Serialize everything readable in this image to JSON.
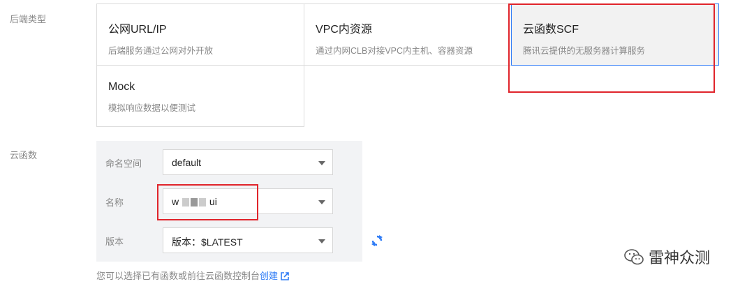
{
  "labels": {
    "backend_type": "后端类型",
    "scf": "云函数"
  },
  "cards": [
    {
      "title": "公网URL/IP",
      "desc": "后端服务通过公网对外开放"
    },
    {
      "title": "VPC内资源",
      "desc": "通过内网CLB对接VPC内主机、容器资源"
    },
    {
      "title": "云函数SCF",
      "desc": "腾讯云提供的无服务器计算服务",
      "selected": true
    },
    {
      "title": "Mock",
      "desc": "模拟响应数据以便测试"
    }
  ],
  "scf": {
    "namespace": {
      "label": "命名空间",
      "value": "default"
    },
    "name": {
      "label": "名称",
      "value_prefix": "w",
      "value_suffix": "ui"
    },
    "version": {
      "label": "版本",
      "value": "版本：$LATEST"
    }
  },
  "hint": {
    "text": "您可以选择已有函数或前往云函数控制台",
    "link": "创建"
  },
  "watermark": {
    "text": "雷神众测"
  },
  "icons": {
    "refresh": "refresh-icon",
    "external": "external-link-icon",
    "watermark": "wechat-icon"
  },
  "colors": {
    "accent": "#2f7cf6",
    "annotation": "#e0242b"
  }
}
